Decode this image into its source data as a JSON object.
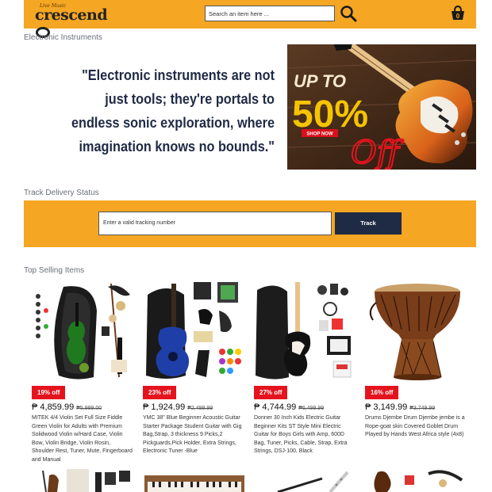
{
  "header": {
    "logo_tagline": "Live Music",
    "logo_text": "crescend",
    "search_placeholder": "Search an item here ...",
    "search_icon": "search-icon",
    "cart_icon": "cart-icon",
    "cart_count": "0"
  },
  "hero": {
    "section_label": "Electronic Instruments",
    "quote": "\"Electronic instruments are not just tools; they're portals to endless sonic exploration, where imagination knows no bounds.\"",
    "banner_line1": "UP TO",
    "banner_line2": "50%",
    "banner_button": "SHOP NOW",
    "banner_off": "Off"
  },
  "track": {
    "section_label": "Track Delivery Status",
    "input_placeholder": "Enter a valid tracking number",
    "button_label": "Track"
  },
  "products": {
    "section_label": "Top Selling Items",
    "items": [
      {
        "discount": "19% off",
        "price": "₱ 4,859.99",
        "old_price": "₱5,999.00",
        "name": "MITEK 4/4 Violin Set Full Size Fiddle Green Violin for Adults with Premium Solidwood Violin w/Hard Case, Violin Bow, Violin Bridge, Violin Rosin, Shoulder Rest, Tuner, Mute, Fingerboard and Manual"
      },
      {
        "discount": "23% off",
        "price": "₱ 1,924.99",
        "old_price": "₱2,499.99",
        "name": "YMC 38\" Blue Beginner Acoustic Guitar Starter Package Student Guitar with Gig Bag,Strap, 3 thickness 9 Picks,2 Pickguards,Pick Holder, Extra Strings, Electronic Tuner -Blue"
      },
      {
        "discount": "27% off",
        "price": "₱ 4,744.99",
        "old_price": "₱6,499.99",
        "name": "Donner 30 Inch Kids Electric Guitar Beginner Kits ST Style Mini Electric Guitar for Boys Girls with Amp, 600D Bag, Tuner, Picks, Cable, Strap, Extra Strings, DSJ-100, Black"
      },
      {
        "discount": "16% off",
        "price": "₱ 3,149.99",
        "old_price": "₱3,749.99",
        "name": "Drums Djembe Drum Djembe jembe is a Rope-goat skin Covered Goblet Drum Played by Hands West Africa style (4x8)"
      }
    ]
  },
  "colors": {
    "accent": "#f5a623",
    "navy": "#1f2a44",
    "discount_red": "#e5131d"
  }
}
